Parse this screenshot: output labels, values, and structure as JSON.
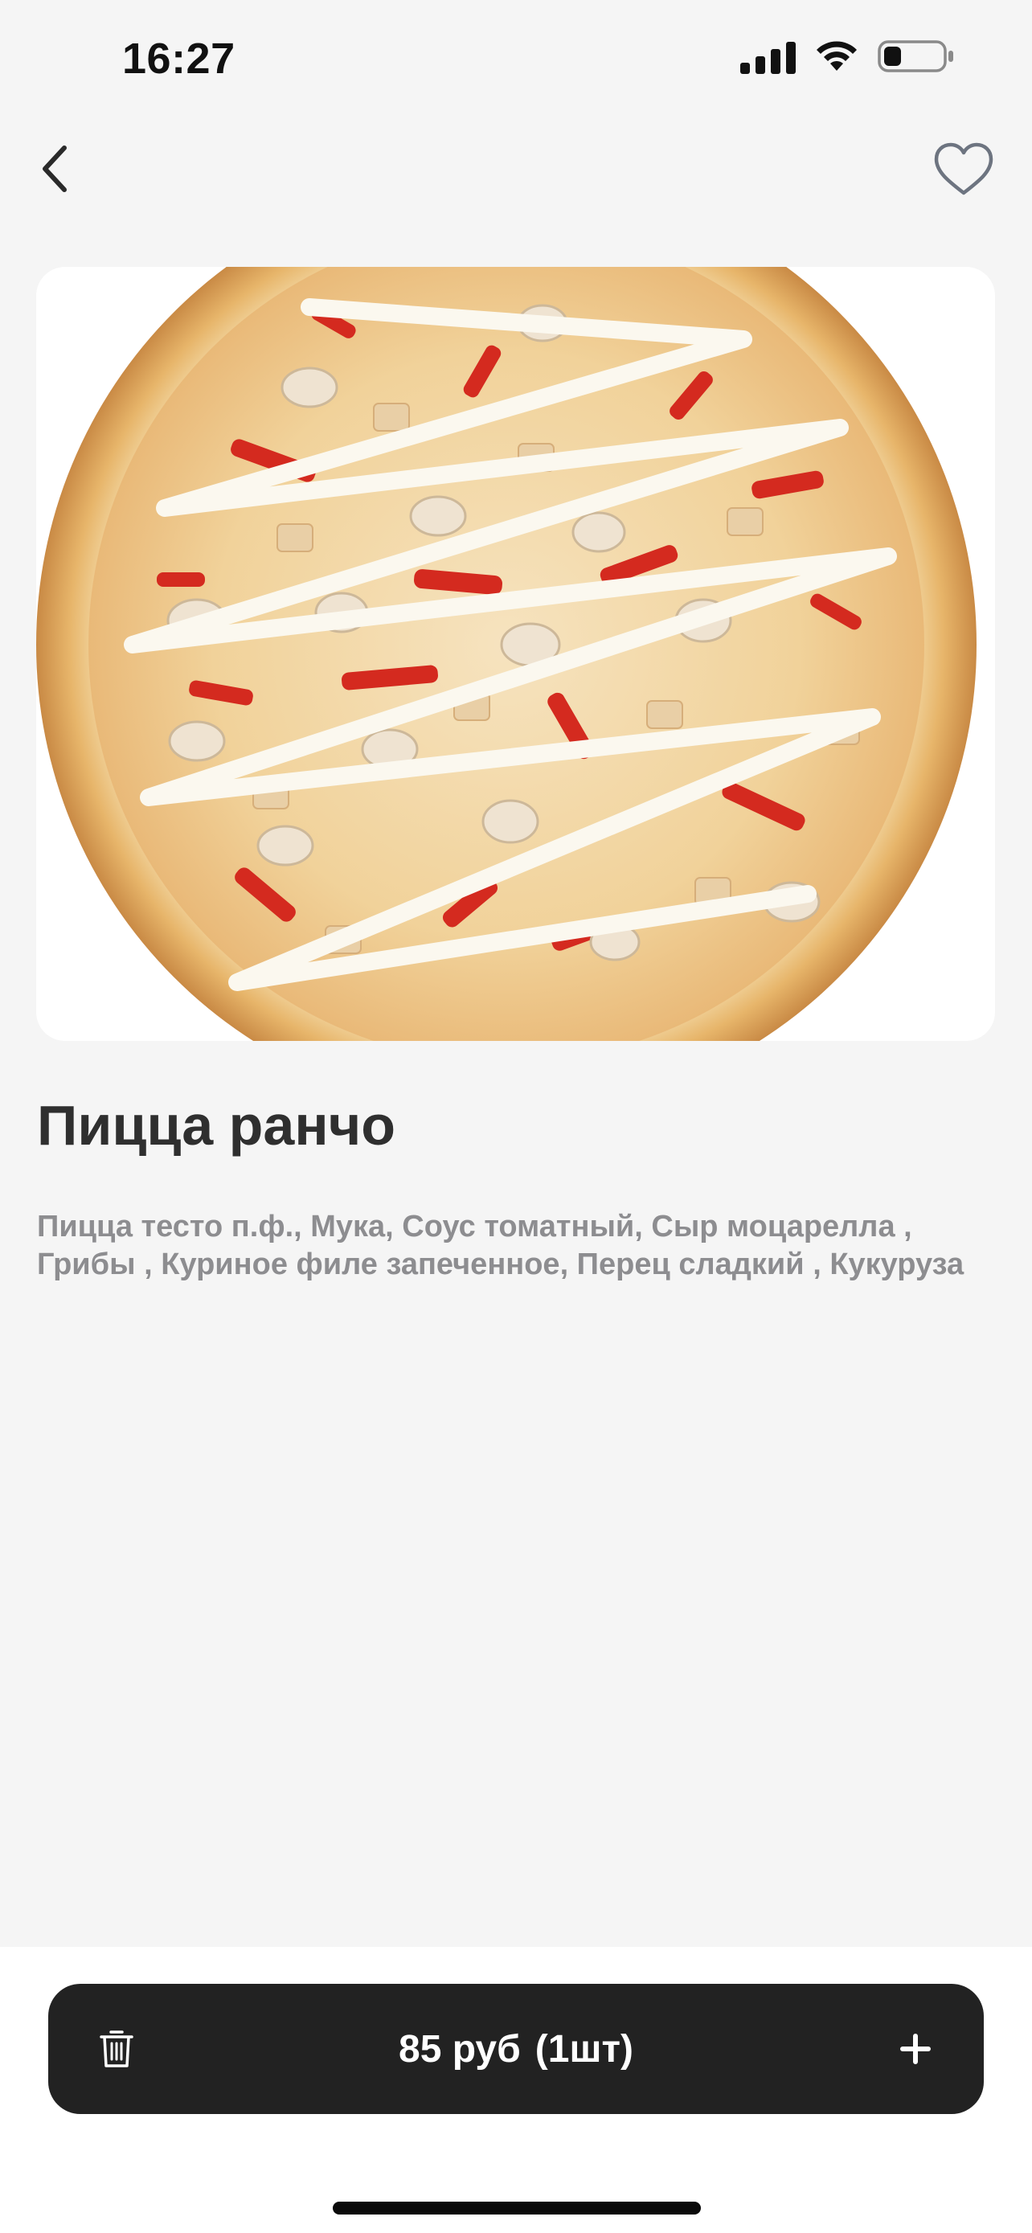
{
  "status_bar": {
    "time": "16:27",
    "battery_level": 0.3
  },
  "nav": {
    "back_icon": "chevron-left-icon",
    "favorite_icon": "heart-outline-icon"
  },
  "product": {
    "image_alt": "pizza-photo",
    "title": "Пицца ранчо",
    "description": "Пицца тесто п.ф., Мука, Соус томатный, Сыр моцарелла , Грибы , Куриное филе запеченное, Перец сладкий , Кукуруза"
  },
  "cart": {
    "price": "85 руб",
    "quantity": "(1шт)",
    "remove_icon": "trash-icon",
    "add_icon": "plus-icon"
  },
  "colors": {
    "background": "#f5f5f5",
    "bar": "#222222",
    "title": "#2f2f2f",
    "description": "#8d8d90"
  }
}
